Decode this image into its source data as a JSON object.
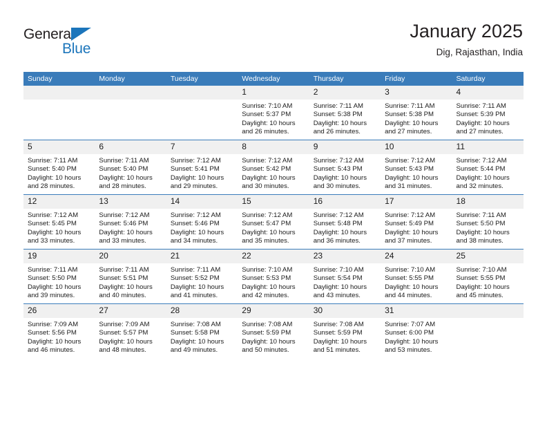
{
  "brand": {
    "name_part1": "General",
    "name_part2": "Blue",
    "accent_color": "#1b75bb"
  },
  "header": {
    "title": "January 2025",
    "location": "Dig, Rajasthan, India"
  },
  "calendar": {
    "header_bg": "#3a7cba",
    "daynum_bg": "#f0f0f0",
    "weekday_headers": [
      "Sunday",
      "Monday",
      "Tuesday",
      "Wednesday",
      "Thursday",
      "Friday",
      "Saturday"
    ],
    "weeks": [
      [
        {
          "day": "",
          "lines": []
        },
        {
          "day": "",
          "lines": []
        },
        {
          "day": "",
          "lines": []
        },
        {
          "day": "1",
          "lines": [
            "Sunrise: 7:10 AM",
            "Sunset: 5:37 PM",
            "Daylight: 10 hours",
            "and 26 minutes."
          ]
        },
        {
          "day": "2",
          "lines": [
            "Sunrise: 7:11 AM",
            "Sunset: 5:38 PM",
            "Daylight: 10 hours",
            "and 26 minutes."
          ]
        },
        {
          "day": "3",
          "lines": [
            "Sunrise: 7:11 AM",
            "Sunset: 5:38 PM",
            "Daylight: 10 hours",
            "and 27 minutes."
          ]
        },
        {
          "day": "4",
          "lines": [
            "Sunrise: 7:11 AM",
            "Sunset: 5:39 PM",
            "Daylight: 10 hours",
            "and 27 minutes."
          ]
        }
      ],
      [
        {
          "day": "5",
          "lines": [
            "Sunrise: 7:11 AM",
            "Sunset: 5:40 PM",
            "Daylight: 10 hours",
            "and 28 minutes."
          ]
        },
        {
          "day": "6",
          "lines": [
            "Sunrise: 7:11 AM",
            "Sunset: 5:40 PM",
            "Daylight: 10 hours",
            "and 28 minutes."
          ]
        },
        {
          "day": "7",
          "lines": [
            "Sunrise: 7:12 AM",
            "Sunset: 5:41 PM",
            "Daylight: 10 hours",
            "and 29 minutes."
          ]
        },
        {
          "day": "8",
          "lines": [
            "Sunrise: 7:12 AM",
            "Sunset: 5:42 PM",
            "Daylight: 10 hours",
            "and 30 minutes."
          ]
        },
        {
          "day": "9",
          "lines": [
            "Sunrise: 7:12 AM",
            "Sunset: 5:43 PM",
            "Daylight: 10 hours",
            "and 30 minutes."
          ]
        },
        {
          "day": "10",
          "lines": [
            "Sunrise: 7:12 AM",
            "Sunset: 5:43 PM",
            "Daylight: 10 hours",
            "and 31 minutes."
          ]
        },
        {
          "day": "11",
          "lines": [
            "Sunrise: 7:12 AM",
            "Sunset: 5:44 PM",
            "Daylight: 10 hours",
            "and 32 minutes."
          ]
        }
      ],
      [
        {
          "day": "12",
          "lines": [
            "Sunrise: 7:12 AM",
            "Sunset: 5:45 PM",
            "Daylight: 10 hours",
            "and 33 minutes."
          ]
        },
        {
          "day": "13",
          "lines": [
            "Sunrise: 7:12 AM",
            "Sunset: 5:46 PM",
            "Daylight: 10 hours",
            "and 33 minutes."
          ]
        },
        {
          "day": "14",
          "lines": [
            "Sunrise: 7:12 AM",
            "Sunset: 5:46 PM",
            "Daylight: 10 hours",
            "and 34 minutes."
          ]
        },
        {
          "day": "15",
          "lines": [
            "Sunrise: 7:12 AM",
            "Sunset: 5:47 PM",
            "Daylight: 10 hours",
            "and 35 minutes."
          ]
        },
        {
          "day": "16",
          "lines": [
            "Sunrise: 7:12 AM",
            "Sunset: 5:48 PM",
            "Daylight: 10 hours",
            "and 36 minutes."
          ]
        },
        {
          "day": "17",
          "lines": [
            "Sunrise: 7:12 AM",
            "Sunset: 5:49 PM",
            "Daylight: 10 hours",
            "and 37 minutes."
          ]
        },
        {
          "day": "18",
          "lines": [
            "Sunrise: 7:11 AM",
            "Sunset: 5:50 PM",
            "Daylight: 10 hours",
            "and 38 minutes."
          ]
        }
      ],
      [
        {
          "day": "19",
          "lines": [
            "Sunrise: 7:11 AM",
            "Sunset: 5:50 PM",
            "Daylight: 10 hours",
            "and 39 minutes."
          ]
        },
        {
          "day": "20",
          "lines": [
            "Sunrise: 7:11 AM",
            "Sunset: 5:51 PM",
            "Daylight: 10 hours",
            "and 40 minutes."
          ]
        },
        {
          "day": "21",
          "lines": [
            "Sunrise: 7:11 AM",
            "Sunset: 5:52 PM",
            "Daylight: 10 hours",
            "and 41 minutes."
          ]
        },
        {
          "day": "22",
          "lines": [
            "Sunrise: 7:10 AM",
            "Sunset: 5:53 PM",
            "Daylight: 10 hours",
            "and 42 minutes."
          ]
        },
        {
          "day": "23",
          "lines": [
            "Sunrise: 7:10 AM",
            "Sunset: 5:54 PM",
            "Daylight: 10 hours",
            "and 43 minutes."
          ]
        },
        {
          "day": "24",
          "lines": [
            "Sunrise: 7:10 AM",
            "Sunset: 5:55 PM",
            "Daylight: 10 hours",
            "and 44 minutes."
          ]
        },
        {
          "day": "25",
          "lines": [
            "Sunrise: 7:10 AM",
            "Sunset: 5:55 PM",
            "Daylight: 10 hours",
            "and 45 minutes."
          ]
        }
      ],
      [
        {
          "day": "26",
          "lines": [
            "Sunrise: 7:09 AM",
            "Sunset: 5:56 PM",
            "Daylight: 10 hours",
            "and 46 minutes."
          ]
        },
        {
          "day": "27",
          "lines": [
            "Sunrise: 7:09 AM",
            "Sunset: 5:57 PM",
            "Daylight: 10 hours",
            "and 48 minutes."
          ]
        },
        {
          "day": "28",
          "lines": [
            "Sunrise: 7:08 AM",
            "Sunset: 5:58 PM",
            "Daylight: 10 hours",
            "and 49 minutes."
          ]
        },
        {
          "day": "29",
          "lines": [
            "Sunrise: 7:08 AM",
            "Sunset: 5:59 PM",
            "Daylight: 10 hours",
            "and 50 minutes."
          ]
        },
        {
          "day": "30",
          "lines": [
            "Sunrise: 7:08 AM",
            "Sunset: 5:59 PM",
            "Daylight: 10 hours",
            "and 51 minutes."
          ]
        },
        {
          "day": "31",
          "lines": [
            "Sunrise: 7:07 AM",
            "Sunset: 6:00 PM",
            "Daylight: 10 hours",
            "and 53 minutes."
          ]
        },
        {
          "day": "",
          "lines": []
        }
      ]
    ]
  }
}
